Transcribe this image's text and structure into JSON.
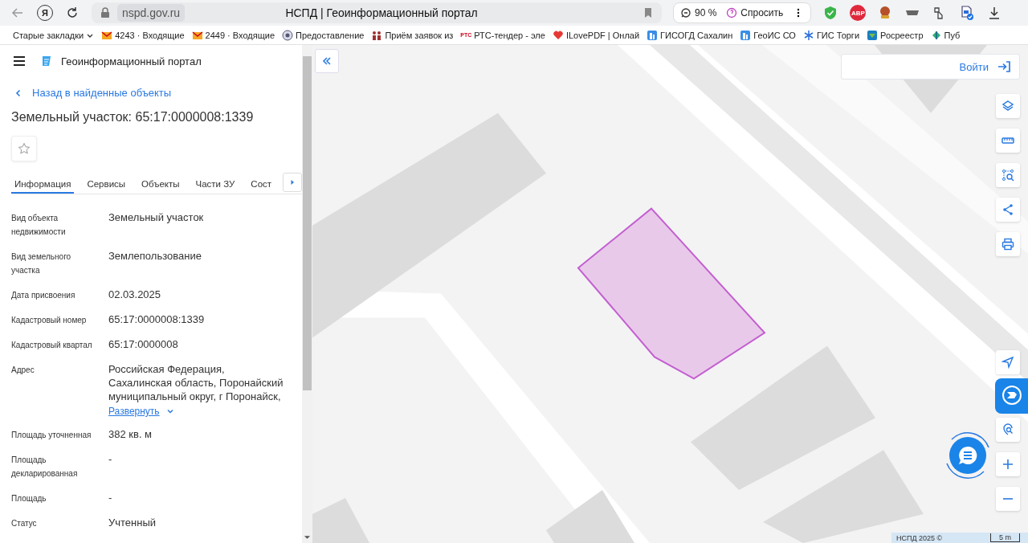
{
  "browser": {
    "logo_letter": "Я",
    "url": "nspd.gov.ru",
    "title": "НСПД | Геоинформационный портал",
    "zoom": "90 %",
    "ask_label": "Спросить",
    "abp_label": "ABP"
  },
  "bookmarks": {
    "folder": "Старые закладки",
    "items": [
      {
        "label": "4243 · Входящие",
        "kind": "mail"
      },
      {
        "label": "2449 · Входящие",
        "kind": "mail"
      },
      {
        "label": "Предоставление",
        "kind": "emblem"
      },
      {
        "label": "Приём заявок из",
        "kind": "people"
      },
      {
        "label": "РТС-тендер - эле",
        "kind": "rts",
        "badge": "РТС"
      },
      {
        "label": "ILovePDF | Онлай",
        "kind": "heart"
      },
      {
        "label": "ГИСОГД Сахалин",
        "kind": "building"
      },
      {
        "label": "ГеоИС СО",
        "kind": "building"
      },
      {
        "label": "ГИС Торги",
        "kind": "snow"
      },
      {
        "label": "Росреестр",
        "kind": "rosreestr"
      },
      {
        "label": "Пуб",
        "kind": "leaf"
      }
    ]
  },
  "panel": {
    "app_title": "Геоинформационный портал",
    "back_link": "Назад в найденные объекты",
    "title": "Земельный участок: 65:17:0000008:1339",
    "favorite": false,
    "tabs": [
      {
        "label": "Информация",
        "selected": true
      },
      {
        "label": "Сервисы",
        "selected": false
      },
      {
        "label": "Объекты",
        "selected": false
      },
      {
        "label": "Части ЗУ",
        "selected": false
      },
      {
        "label": "Сост",
        "selected": false
      }
    ],
    "fields": [
      {
        "label": "Вид объекта недвижимости",
        "value": "Земельный участок"
      },
      {
        "label": "Вид земельного участка",
        "value": "Землепользование"
      },
      {
        "label": "Дата присвоения",
        "value": "02.03.2025"
      },
      {
        "label": "Кадастровый номер",
        "value": "65:17:0000008:1339"
      },
      {
        "label": "Кадастровый квартал",
        "value": "65:17:0000008"
      },
      {
        "label": "Адрес",
        "value": "Российская Федерация,\nСахалинская область, Поронайский\nмуниципальный округ, г Поронайск,",
        "expand_link": "Развернуть"
      },
      {
        "label": "Площадь уточненная",
        "value": "382 кв. м"
      },
      {
        "label": "Площадь декларированная",
        "value": "-"
      },
      {
        "label": "Площадь",
        "value": "-"
      },
      {
        "label": "Статус",
        "value": "Учтенный"
      }
    ]
  },
  "map": {
    "login": "Войти",
    "attribution": "НСПД 2025 ©",
    "scale": "5 m"
  }
}
